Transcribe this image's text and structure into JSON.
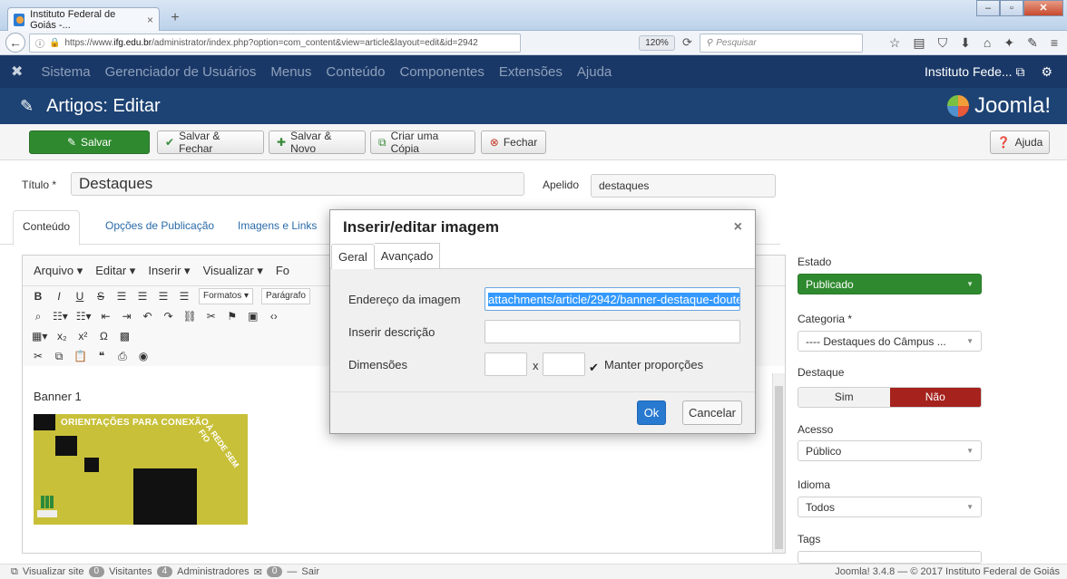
{
  "browser": {
    "tab_title": "Instituto Federal de Goiás -...",
    "tab_close": "×",
    "new_tab": "+",
    "url_prefix": "https://www.",
    "url_domain": "ifg.edu.br",
    "url_path": "/administrator/index.php?option=com_content&view=article&layout=edit&id=2942",
    "zoom": "120%",
    "search_placeholder": "Pesquisar"
  },
  "admin_menu": {
    "items": [
      "Sistema",
      "Gerenciador de Usuários",
      "Menus",
      "Conteúdo",
      "Componentes",
      "Extensões",
      "Ajuda"
    ],
    "site_name": "Instituto Fede...",
    "brand": "Joomla!"
  },
  "page_title": "Artigos: Editar",
  "toolbar": {
    "save": "Salvar",
    "save_close": "Salvar & Fechar",
    "save_new": "Salvar & Novo",
    "copy": "Criar uma Cópia",
    "close": "Fechar",
    "help": "Ajuda"
  },
  "form": {
    "title_label": "Título *",
    "title_value": "Destaques",
    "alias_label": "Apelido",
    "alias_value": "destaques",
    "tabs": [
      "Conteúdo",
      "Opções de Publicação",
      "Imagens e Links"
    ]
  },
  "editor": {
    "menus": [
      "Arquivo ▾",
      "Editar ▾",
      "Inserir ▾",
      "Visualizar ▾",
      "Fo"
    ],
    "formats": "Formatos ▾",
    "paragraph": "Parágrafo",
    "content_text": "Banner 1",
    "banner_text": "ORIENTAÇÕES PARA CONEXÃO",
    "banner_side": "À REDE SEM FIO"
  },
  "sidebar": {
    "status_label": "Estado",
    "status_value": "Publicado",
    "category_label": "Categoria *",
    "category_value": "---- Destaques do Câmpus ...",
    "featured_label": "Destaque",
    "featured_yes": "Sim",
    "featured_no": "Não",
    "access_label": "Acesso",
    "access_value": "Público",
    "language_label": "Idioma",
    "language_value": "Todos",
    "tags_label": "Tags"
  },
  "modal": {
    "title": "Inserir/editar imagem",
    "close": "×",
    "tab_general": "Geral",
    "tab_advanced": "Avançado",
    "src_label": "Endereço da imagem",
    "src_value": "attachments/article/2942/banner-destaque-doute",
    "desc_label": "Inserir descrição",
    "desc_value": "",
    "dim_label": "Dimensões",
    "dim_sep": "x",
    "constrain_label": "Manter proporções",
    "ok": "Ok",
    "cancel": "Cancelar"
  },
  "status": {
    "view_site": "Visualizar site",
    "visitors_count": "0",
    "visitors": "Visitantes",
    "admins_count": "4",
    "admins": "Administradores",
    "messages_count": "0",
    "logout": "Sair",
    "copyright": "Joomla! 3.4.8 — © 2017 Instituto Federal de Goiás"
  },
  "colors": {
    "menu_bg": "#1a3867",
    "title_bg": "#1d4374",
    "published": "#2f8a2f",
    "no_active": "#a5221d",
    "ok_button": "#2879d0"
  }
}
